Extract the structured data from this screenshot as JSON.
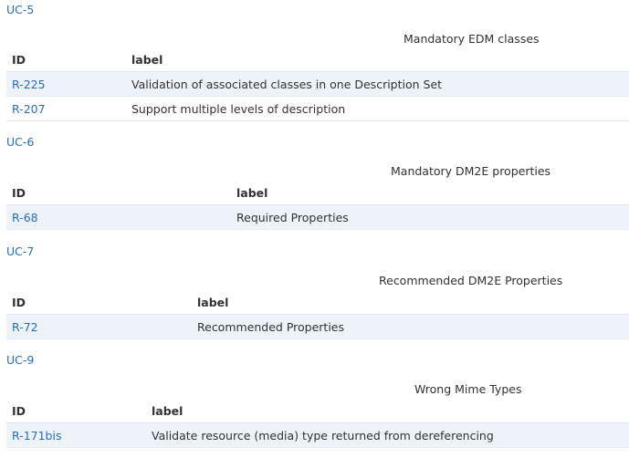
{
  "sections": [
    {
      "uc": "UC-5",
      "caption": "Mandatory EDM classes",
      "headers": {
        "id": "ID",
        "label": "label"
      },
      "rows": [
        {
          "id": "R-225",
          "label": "Validation of associated classes in one Description Set"
        },
        {
          "id": "R-207",
          "label": "Support multiple levels of description"
        }
      ]
    },
    {
      "uc": "UC-6",
      "caption": "Mandatory DM2E properties",
      "headers": {
        "id": "ID",
        "label": "label"
      },
      "rows": [
        {
          "id": "R-68",
          "label": "Required Properties"
        }
      ]
    },
    {
      "uc": "UC-7",
      "caption": "Recommended DM2E Properties",
      "headers": {
        "id": "ID",
        "label": "label"
      },
      "rows": [
        {
          "id": "R-72",
          "label": "Recommended Properties"
        }
      ]
    },
    {
      "uc": "UC-9",
      "caption": "Wrong Mime Types",
      "headers": {
        "id": "ID",
        "label": "label"
      },
      "rows": [
        {
          "id": "R-171bis",
          "label": "Validate resource (media) type returned from dereferencing"
        }
      ]
    }
  ],
  "colors": {
    "link": "#2a6ebb",
    "row_stripe": "#edf3f9",
    "text": "#333333"
  }
}
